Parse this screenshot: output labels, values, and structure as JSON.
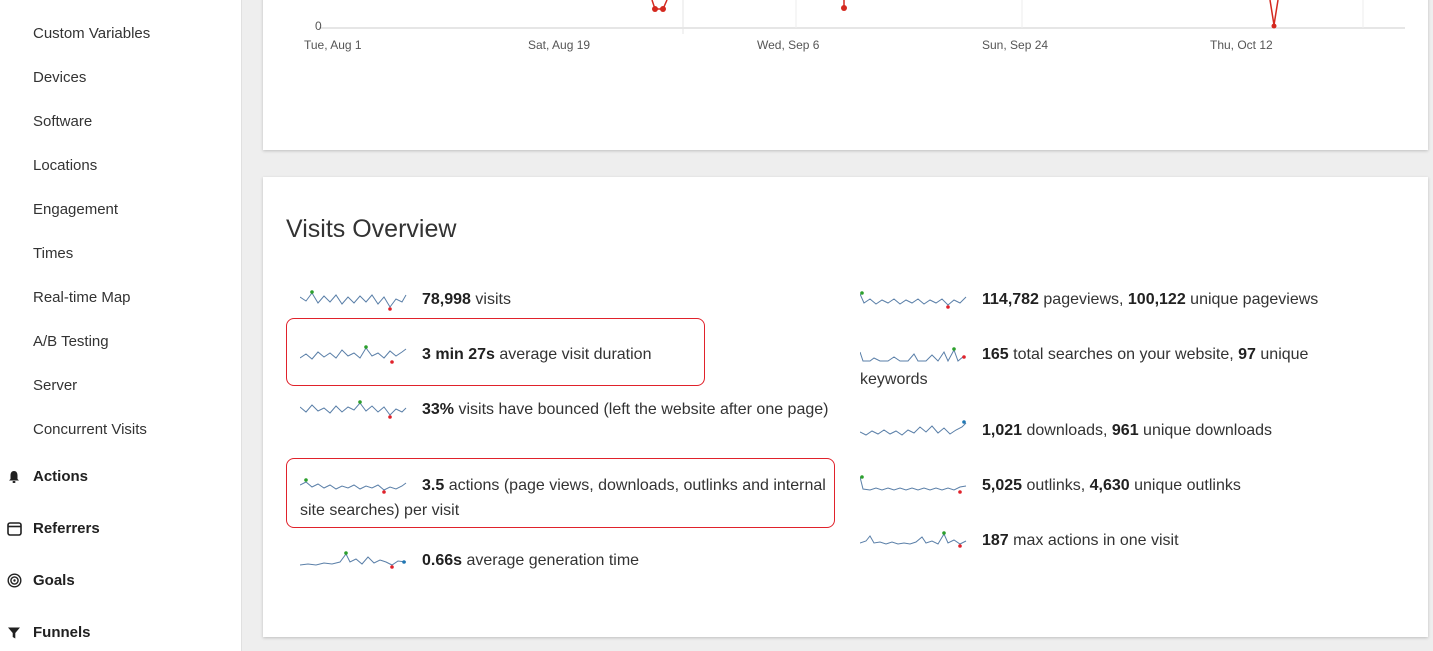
{
  "sidebar": {
    "sub_items": [
      "Custom Variables",
      "Devices",
      "Software",
      "Locations",
      "Engagement",
      "Times",
      "Real-time Map",
      "A/B Testing",
      "Server",
      "Concurrent Visits"
    ],
    "categories": [
      {
        "label": "Actions",
        "icon": "bell-icon"
      },
      {
        "label": "Referrers",
        "icon": "window-icon"
      },
      {
        "label": "Goals",
        "icon": "target-icon"
      },
      {
        "label": "Funnels",
        "icon": "funnel-icon"
      }
    ]
  },
  "evolution_graph": {
    "y_zero_label": "0",
    "x_ticks": [
      "Tue, Aug 1",
      "Sat, Aug 19",
      "Wed, Sep 6",
      "Sun, Sep 24",
      "Thu, Oct 12"
    ]
  },
  "visits_overview": {
    "title": "Visits Overview",
    "left": [
      {
        "value": "78,998",
        "text": " visits"
      },
      {
        "value": "3 min 27s",
        "text": " average visit duration"
      },
      {
        "value": "33%",
        "text": " visits have bounced (left the website after one page)"
      },
      {
        "value": "3.5",
        "text": " actions (page views, downloads, outlinks and internal site searches) per visit"
      },
      {
        "value": "0.66s",
        "text": " average generation time"
      }
    ],
    "right": [
      {
        "value": "114,782",
        "text": " pageviews, ",
        "value2": "100,122",
        "text2": " unique pageviews"
      },
      {
        "value": "165",
        "text": " total searches on your website, ",
        "value2": "97",
        "text2": " unique keywords"
      },
      {
        "value": "1,021",
        "text": " downloads, ",
        "value2": "961",
        "text2": " unique downloads"
      },
      {
        "value": "5,025",
        "text": " outlinks, ",
        "value2": "4,630",
        "text2": " unique outlinks"
      },
      {
        "value": "187",
        "text": " max actions in one visit"
      }
    ]
  },
  "colors": {
    "highlight_border": "#e0222b",
    "graph_line": "#d4291f",
    "sparkline": "#5a7fa8",
    "sparkline_max": "#2ca02c",
    "sparkline_min": "#e0222b",
    "sparkline_last": "#1f77b4"
  }
}
